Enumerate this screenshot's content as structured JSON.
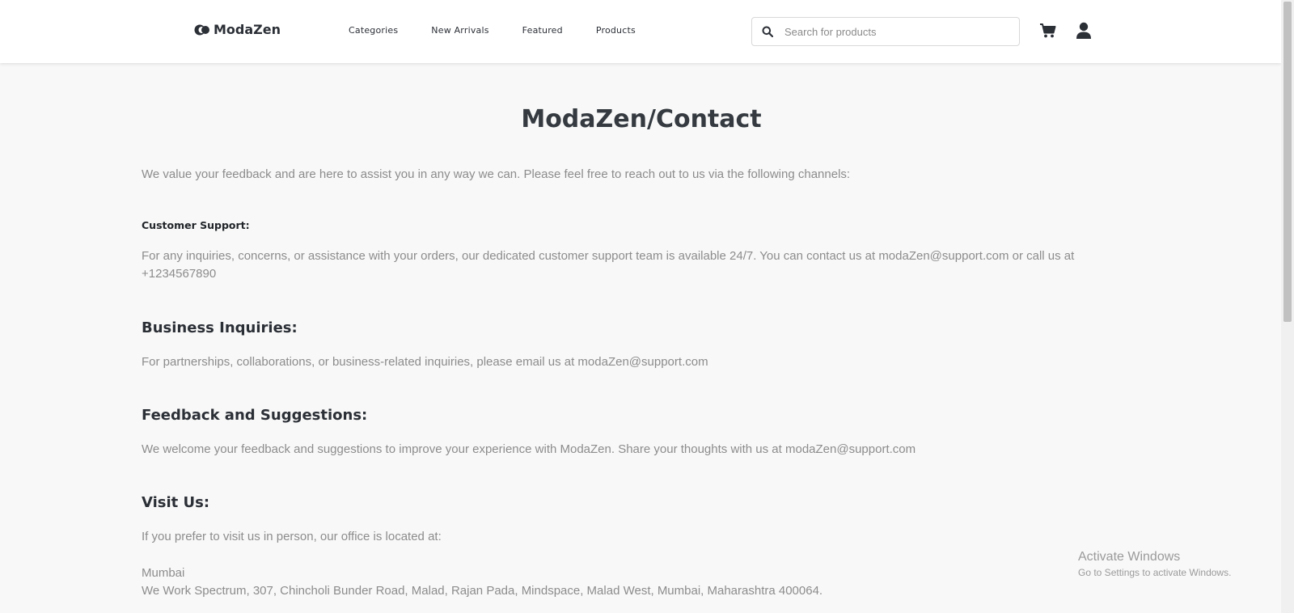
{
  "header": {
    "brand": "ModaZen",
    "nav": [
      "Categories",
      "New Arrivals",
      "Featured",
      "Products"
    ],
    "search_placeholder": "Search for products"
  },
  "page": {
    "title": "ModaZen/Contact",
    "intro": "We value your feedback and are here to assist you in any way we can. Please feel free to reach out to us via the following channels:",
    "customer_support": {
      "heading": "Customer Support:",
      "text_line1": "For any inquiries, concerns, or assistance with your orders, our dedicated customer support team is available 24/7. You can contact us at modaZen@support.com or call us at",
      "text_line2": "+1234567890"
    },
    "business": {
      "heading": "Business Inquiries:",
      "text": "For partnerships, collaborations, or business-related inquiries, please email us at modaZen@support.com"
    },
    "feedback": {
      "heading": "Feedback and Suggestions:",
      "text": "We welcome your feedback and suggestions to improve your experience with ModaZen. Share your thoughts with us at modaZen@support.com"
    },
    "visit": {
      "heading": "Visit Us:",
      "text": "If you prefer to visit us in person, our office is located at:",
      "city": "Mumbai",
      "address": "We Work Spectrum, 307, Chincholi Bunder Road, Malad, Rajan Pada, Mindspace, Malad West, Mumbai, Maharashtra 400064."
    }
  },
  "watermark": {
    "title": "Activate Windows",
    "subtitle": "Go to Settings to activate Windows."
  }
}
